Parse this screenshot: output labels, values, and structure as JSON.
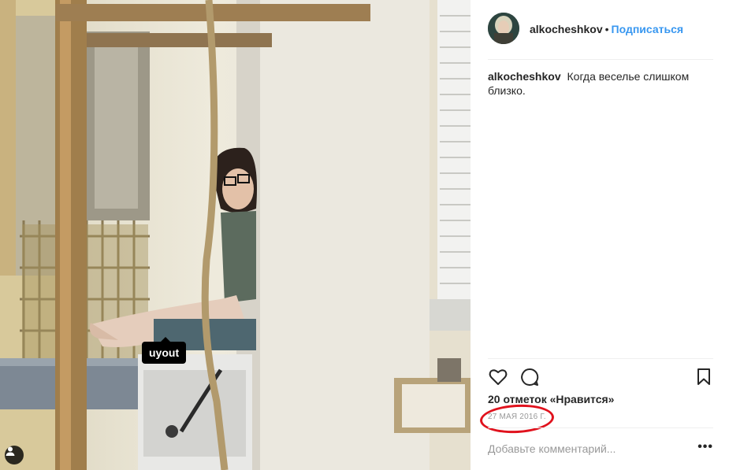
{
  "post": {
    "username": "alkocheshkov",
    "separator": "•",
    "follow_label": "Подписаться",
    "caption_text": "Когда веселье слишком близко.",
    "likes_text": "20 отметок «Нравится»",
    "date_text": "27 мая 2016 г.",
    "comment_placeholder": "Добавьте комментарий...",
    "more_label": "•••"
  },
  "photo": {
    "tag_label": "uyout",
    "icons": {
      "user_tag": "user-tag-icon",
      "like": "heart-icon",
      "comment": "comment-bubble-icon",
      "save": "bookmark-icon"
    }
  },
  "colors": {
    "follow_blue": "#3897f0",
    "annotation_red": "#e0121d",
    "text": "#262626",
    "muted": "#999999"
  }
}
